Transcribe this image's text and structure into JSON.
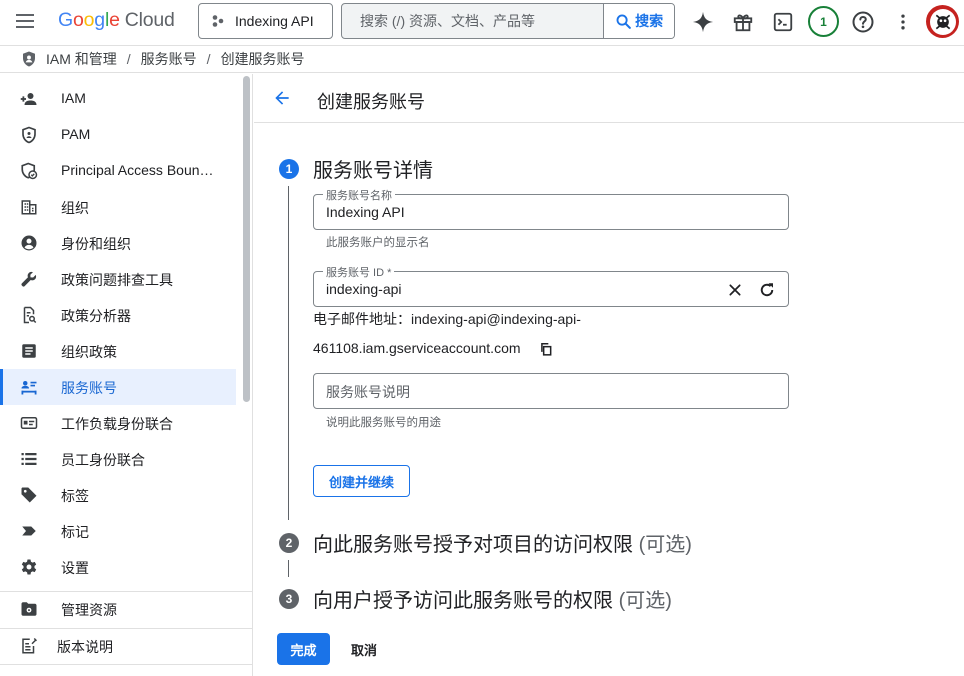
{
  "header": {
    "logo": {
      "g1": "G",
      "g2": "o",
      "g3": "o",
      "g4": "g",
      "g5": "l",
      "g6": "e",
      "cloud": "Cloud"
    },
    "project": "Indexing API",
    "search_placeholder": "搜索 (/) 资源、文档、产品等",
    "search_button": "搜索",
    "notification_count": "1"
  },
  "breadcrumb": {
    "items": [
      "IAM 和管理",
      "服务账号",
      "创建服务账号"
    ],
    "separator": "/"
  },
  "sidebar": {
    "items": [
      {
        "label": "IAM",
        "icon": "person-add-icon"
      },
      {
        "label": "PAM",
        "icon": "shield-icon"
      },
      {
        "label": "Principal Access Boundary Policies",
        "icon": "policy-shield-icon"
      },
      {
        "label": "组织",
        "icon": "building-icon"
      },
      {
        "label": "身份和组织",
        "icon": "account-circle-icon"
      },
      {
        "label": "政策问题排查工具",
        "icon": "wrench-icon"
      },
      {
        "label": "政策分析器",
        "icon": "document-search-icon"
      },
      {
        "label": "组织政策",
        "icon": "list-document-icon"
      },
      {
        "label": "服务账号",
        "icon": "service-account-icon",
        "active": true
      },
      {
        "label": "工作负载身份联合",
        "icon": "id-card-icon"
      },
      {
        "label": "员工身份联合",
        "icon": "list-icon"
      },
      {
        "label": "标签",
        "icon": "tag-icon"
      },
      {
        "label": "标记",
        "icon": "label-icon"
      },
      {
        "label": "设置",
        "icon": "gear-icon"
      }
    ],
    "manage_resources": "管理资源",
    "release_notes": "版本说明"
  },
  "main": {
    "title": "创建服务账号",
    "step1": {
      "number": "1",
      "title": "服务账号详情",
      "name_label": "服务账号名称",
      "name_value": "Indexing API",
      "name_hint": "此服务账户的显示名",
      "id_label": "服务账号 ID *",
      "id_value": "indexing-api",
      "email_prefix": "电子邮件地址：indexing-api@indexing-api-",
      "email_suffix": "461108.iam.gserviceaccount.com",
      "desc_placeholder": "服务账号说明",
      "desc_hint": "说明此服务账号的用途",
      "create_button": "创建并继续"
    },
    "step2": {
      "number": "2",
      "title": "向此服务账号授予对项目的访问权限",
      "optional": "(可选)"
    },
    "step3": {
      "number": "3",
      "title": "向用户授予访问此服务账号的权限",
      "optional": "(可选)"
    },
    "done_button": "完成",
    "cancel_button": "取消"
  },
  "colors": {
    "accent": "#1a73e8",
    "active_bg": "#e8f0fe",
    "muted": "#5f6368",
    "badge_green": "#188038"
  }
}
